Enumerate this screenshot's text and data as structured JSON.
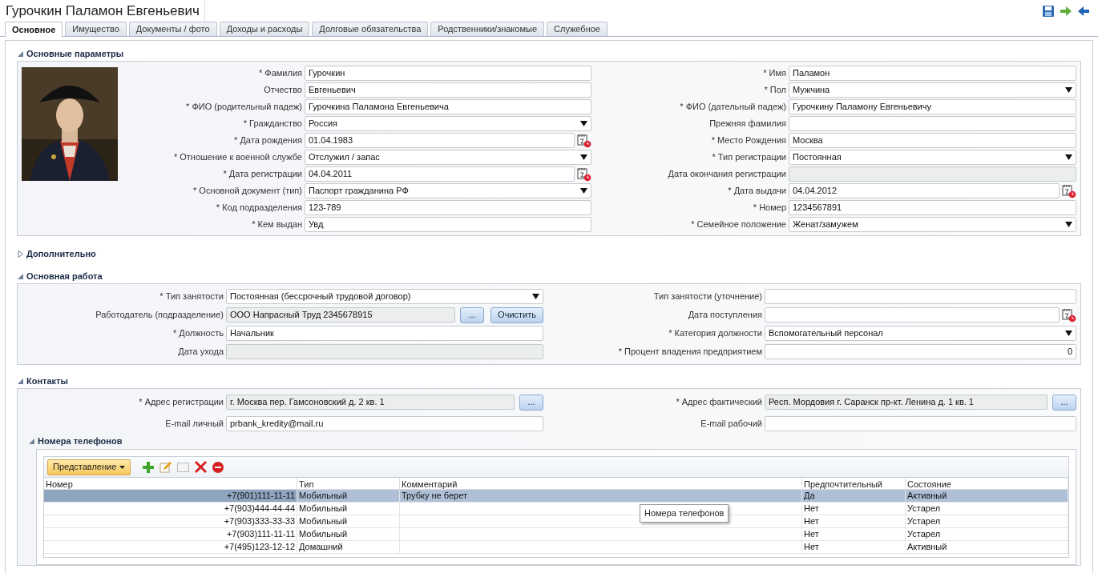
{
  "title": "Гурочкин Паламон Евгеньевич",
  "tabs": [
    {
      "label": "Основное",
      "selected": true
    },
    {
      "label": "Имущество",
      "selected": false
    },
    {
      "label": "Документы / фото",
      "selected": false
    },
    {
      "label": "Доходы и расходы",
      "selected": false
    },
    {
      "label": "Долговые обязательства",
      "selected": false
    },
    {
      "label": "Родственники/знакомые",
      "selected": false
    },
    {
      "label": "Служебное",
      "selected": false
    }
  ],
  "main": {
    "title": "Основные параметры",
    "expanded": true,
    "left": [
      {
        "label": "* Фамилия",
        "kind": "text",
        "value": "Гурочкин"
      },
      {
        "label": "Отчество",
        "kind": "text",
        "value": "Евгеньевич"
      },
      {
        "label": "* ФИО (родительный падеж)",
        "kind": "text",
        "value": "Гурочкина Паламона Евгеньевича"
      },
      {
        "label": "* Гражданство",
        "kind": "select",
        "value": "Россия"
      },
      {
        "label": "* Дата рождения",
        "kind": "date",
        "value": "01.04.1983"
      },
      {
        "label": "* Отношение к военной службе",
        "kind": "select",
        "value": "Отслужил / запас"
      },
      {
        "label": "* Дата регистрации",
        "kind": "date",
        "value": "04.04.2011"
      },
      {
        "label": "* Основной документ (тип)",
        "kind": "select",
        "value": "Паспорт гражданина РФ"
      },
      {
        "label": "* Код подразделения",
        "kind": "text",
        "value": "123-789"
      },
      {
        "label": "* Кем выдан",
        "kind": "text",
        "value": "Увд"
      }
    ],
    "right": [
      {
        "label": "* Имя",
        "kind": "text",
        "value": "Паламон"
      },
      {
        "label": "* Пол",
        "kind": "select",
        "value": "Мужчина"
      },
      {
        "label": "* ФИО (дательный падеж)",
        "kind": "text",
        "value": "Гурочкину Паламону Евгеньевичу"
      },
      {
        "label": "Прежняя фамилия",
        "kind": "text"
      },
      {
        "label": "* Место Рождения",
        "kind": "text",
        "value": "Москва"
      },
      {
        "label": "* Тип регистрации",
        "kind": "select",
        "value": "Постоянная"
      },
      {
        "label": "Дата окончания регистрации",
        "kind": "disabled"
      },
      {
        "label": "* Дата выдачи",
        "kind": "date",
        "value": "04.04.2012"
      },
      {
        "label": "* Номер",
        "kind": "text",
        "value": "1234567891"
      },
      {
        "label": "* Семейное положение",
        "kind": "select",
        "value": "Женат/замужем"
      }
    ]
  },
  "extra": {
    "title": "Дополнительно",
    "expanded": false
  },
  "work": {
    "title": "Основная работа",
    "expanded": true,
    "left": [
      {
        "label": "* Тип занятости",
        "kind": "select",
        "value": "Постоянная (бессрочный трудовой договор)"
      },
      {
        "label": "Работодатель (подразделение)",
        "kind": "lookup",
        "value": "ООО Напрасный Труд 2345678915",
        "button": "...",
        "clear_button": "Очистить"
      },
      {
        "label": "* Должность",
        "kind": "text",
        "value": "Начальник"
      },
      {
        "label": "Дата ухода",
        "kind": "disabled"
      }
    ],
    "right": [
      {
        "label": "Тип занятости (уточнение)",
        "kind": "text"
      },
      {
        "label": "Дата поступления",
        "kind": "date"
      },
      {
        "label": "* Категория должности",
        "kind": "select",
        "value": "Вспомогательный персонал"
      },
      {
        "label": "* Процент владения предприятием",
        "kind": "number",
        "value": "0"
      }
    ]
  },
  "contacts": {
    "title": "Контакты",
    "expanded": true,
    "left": [
      {
        "label": "* Адрес регистрации",
        "kind": "lookup",
        "value": "г. Москва пер. Гамсоновский д. 2 кв. 1",
        "button": "..."
      },
      {
        "label": "E-mail личный",
        "kind": "text",
        "value": "prbank_kredity@mail.ru"
      }
    ],
    "right": [
      {
        "label": "* Адрес фактический",
        "kind": "lookup",
        "value": "Респ. Мордовия г. Саранск пр-кт. Ленина д. 1 кв. 1",
        "button": "..."
      },
      {
        "label": "E-mail рабочий",
        "kind": "text"
      }
    ],
    "phones": {
      "title": "Номера телефонов",
      "expanded": true,
      "view_button": "Представление",
      "tooltip": "Номера телефонов",
      "columns": [
        "Номер",
        "Тип",
        "Комментарий",
        "Предпочтительный",
        "Состояние"
      ],
      "rows": [
        {
          "selected": true,
          "cells": [
            "+7(901)111-11-11",
            "Мобильный",
            "Трубку не берет",
            "Да",
            "Активный"
          ]
        },
        {
          "selected": false,
          "cells": [
            "+7(903)444-44-44",
            "Мобильный",
            "",
            "Нет",
            "Устарел"
          ]
        },
        {
          "selected": false,
          "cells": [
            "+7(903)333-33-33",
            "Мобильный",
            "",
            "Нет",
            "Устарел"
          ]
        },
        {
          "selected": false,
          "cells": [
            "+7(903)111-11-11",
            "Мобильный",
            "",
            "Нет",
            "Устарел"
          ]
        },
        {
          "selected": false,
          "cells": [
            "+7(495)123-12-12",
            "Домашний",
            "",
            "Нет",
            "Активный"
          ]
        }
      ]
    }
  }
}
